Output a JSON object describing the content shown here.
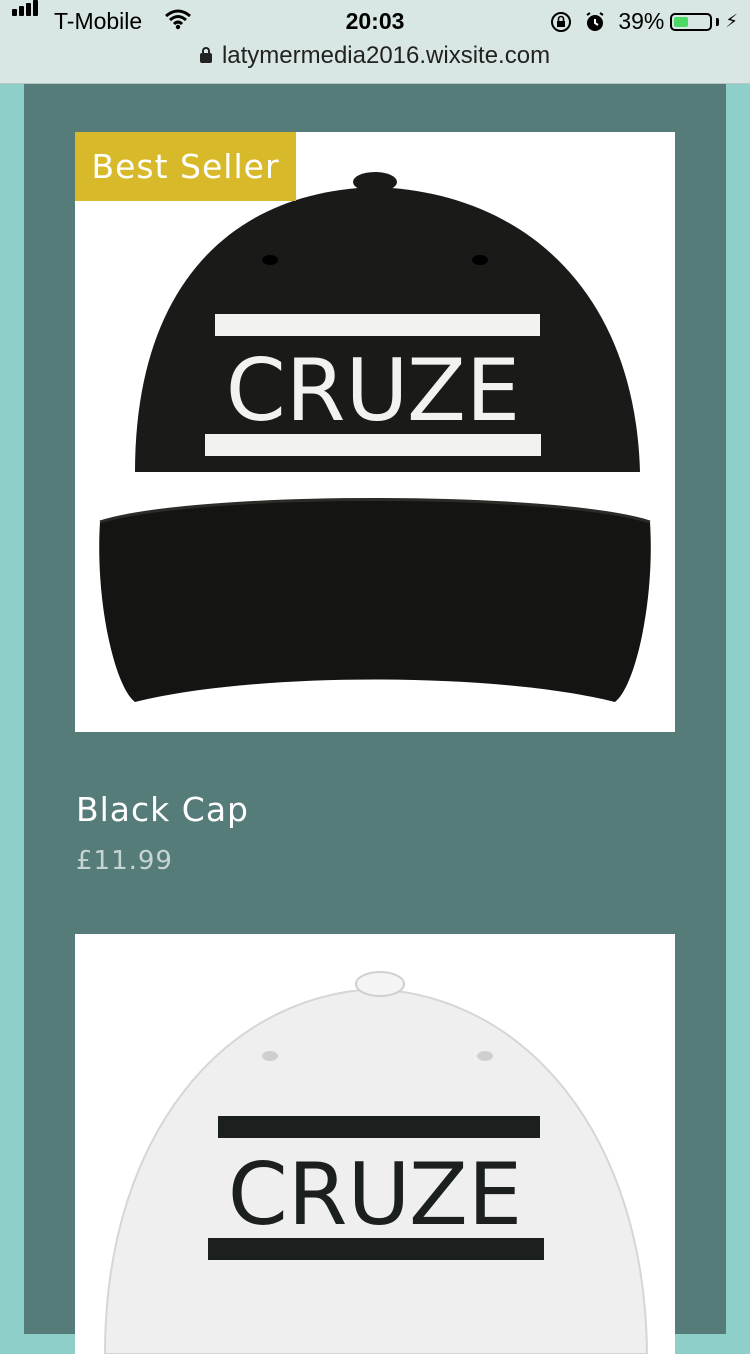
{
  "status": {
    "carrier": "T-Mobile",
    "time": "20:03",
    "battery_percent": "39%",
    "battery_level": 0.39
  },
  "browser": {
    "url": "latymermedia2016.wixsite.com"
  },
  "products": [
    {
      "badge": "Best Seller",
      "name": "Black Cap",
      "price": "£11.99",
      "image_text": "CRUZE",
      "image_color": "#1a1a18"
    },
    {
      "image_text": "CRUZE",
      "image_color": "#f0f0f0"
    }
  ],
  "colors": {
    "page_bg": "#8ecfca",
    "panel_bg": "#557c78",
    "badge_bg": "#d8b92a"
  }
}
